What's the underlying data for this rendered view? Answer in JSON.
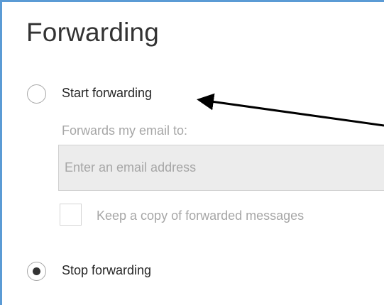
{
  "title": "Forwarding",
  "start_forwarding": {
    "label": "Start forwarding",
    "selected": false
  },
  "forward_to": {
    "label": "Forwards my email to:",
    "value": "",
    "placeholder": "Enter an email address"
  },
  "keep_copy": {
    "label": "Keep a copy of forwarded messages",
    "checked": false
  },
  "stop_forwarding": {
    "label": "Stop forwarding",
    "selected": true
  },
  "colors": {
    "frame_border": "#5b9bd5",
    "title_text": "#333333",
    "disabled_text": "#a6a6a6",
    "input_background": "#ececec",
    "annotation_arrow": "#000000"
  },
  "annotation": {
    "type": "arrow",
    "points_to": "start-forwarding-label"
  }
}
